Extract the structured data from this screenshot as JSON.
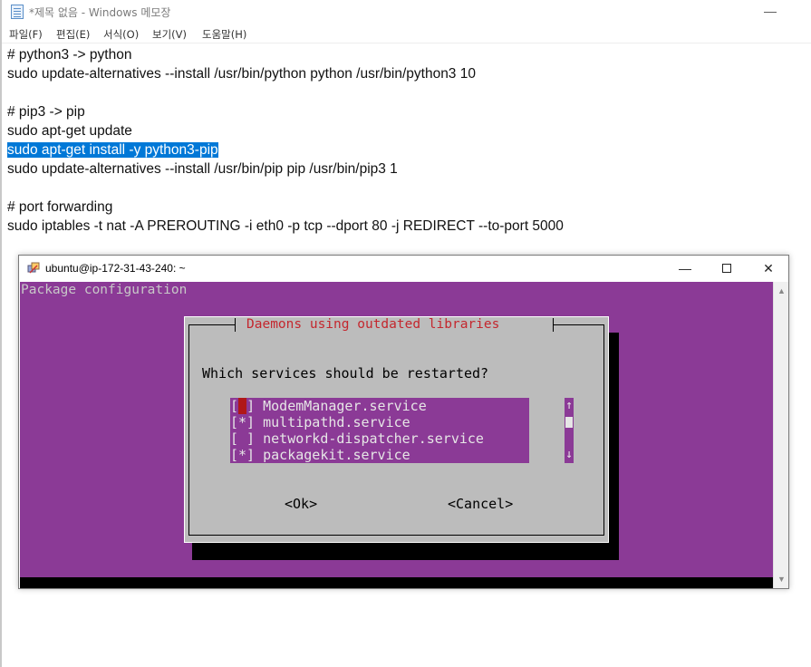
{
  "notepad": {
    "title": "*제목 없음 - Windows 메모장",
    "minimize_glyph": "—",
    "menu": [
      {
        "label": "파일(F)"
      },
      {
        "label": "편집(E)"
      },
      {
        "label": "서식(O)"
      },
      {
        "label": "보기(V)"
      },
      {
        "label": "도움말(H)"
      }
    ],
    "lines": [
      {
        "text": "# python3 -> python"
      },
      {
        "text": "sudo update-alternatives --install /usr/bin/python python /usr/bin/python3 10"
      },
      {
        "text": ""
      },
      {
        "text": "# pip3 -> pip"
      },
      {
        "text": "sudo apt-get update"
      },
      {
        "text": "sudo apt-get install -y python3-pip",
        "selected": true
      },
      {
        "text": "sudo update-alternatives --install /usr/bin/pip pip /usr/bin/pip3 1"
      },
      {
        "text": ""
      },
      {
        "text": "# port forwarding"
      },
      {
        "text": "sudo iptables -t nat -A PREROUTING -i eth0 -p tcp --dport 80 -j REDIRECT --to-port 5000"
      }
    ],
    "selection_color": "#0078d7"
  },
  "terminal": {
    "title": "ubuntu@ip-172-31-43-240: ~",
    "icon": "putty-icon",
    "minimize_glyph": "—",
    "close_glyph": "✕",
    "background_color": "#8b3a96",
    "header": "Package configuration",
    "dialog": {
      "title": "Daemons using outdated libraries",
      "prompt": "Which services should be restarted?",
      "services": [
        {
          "mark": "[ ]",
          "name": "ModemManager.service",
          "checked": false,
          "focused": true
        },
        {
          "mark": "[*]",
          "name": "multipathd.service",
          "checked": true,
          "focused": false
        },
        {
          "mark": "[ ]",
          "name": "networkd-dispatcher.service",
          "checked": false,
          "focused": false
        },
        {
          "mark": "[*]",
          "name": "packagekit.service",
          "checked": true,
          "focused": false
        }
      ],
      "scroll_up": "↑",
      "scroll_down": "↓",
      "ok_label": "<Ok>",
      "cancel_label": "<Cancel>",
      "title_color": "#c4272e",
      "cursor_color": "#b01818"
    }
  }
}
